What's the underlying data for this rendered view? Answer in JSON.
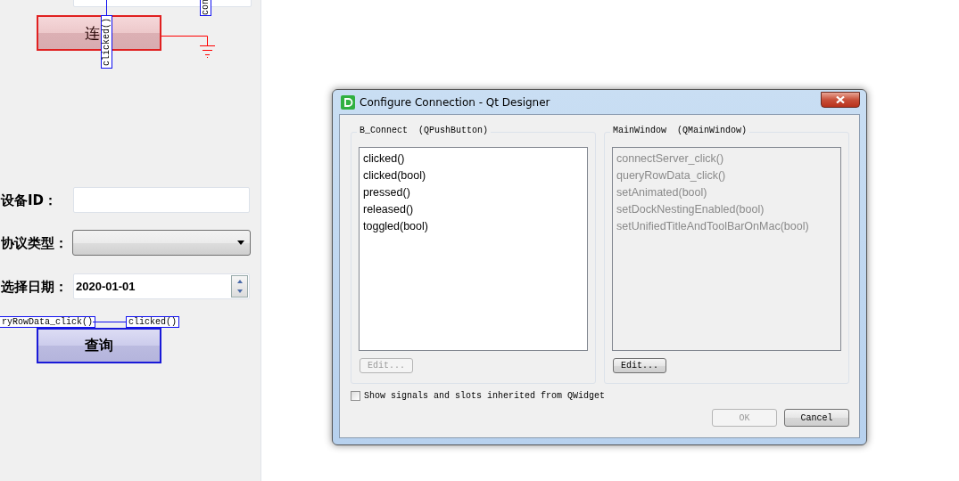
{
  "form": {
    "connect_button": {
      "label": "连"
    },
    "connections": [
      {
        "kind": "vertical",
        "signal": "clicked()",
        "slot": "con"
      },
      {
        "kind": "horizontal",
        "signal": "clicked()",
        "slot": "ryRowData_click()"
      }
    ],
    "fields": [
      {
        "kind": "text",
        "label": "设备ID："
      },
      {
        "kind": "combo",
        "label": "协议类型："
      },
      {
        "kind": "date",
        "label": "选择日期：",
        "value": "2020-01-01"
      }
    ],
    "query_button": {
      "label": "查询"
    }
  },
  "dialog": {
    "title": "Configure Connection - Qt Designer",
    "panels": [
      {
        "heading": "B_Connect  (QPushButton)",
        "disabled": false,
        "items": [
          "clicked()",
          "clicked(bool)",
          "pressed()",
          "released()",
          "toggled(bool)"
        ],
        "edit_button": {
          "label": "Edit...",
          "disabled": true
        }
      },
      {
        "heading": "MainWindow  (QMainWindow)",
        "disabled": true,
        "items": [
          "connectServer_click()",
          "queryRowData_click()",
          "setAnimated(bool)",
          "setDockNestingEnabled(bool)",
          "setUnifiedTitleAndToolBarOnMac(bool)"
        ],
        "edit_button": {
          "label": "Edit...",
          "disabled": false
        }
      }
    ],
    "inherited_checkbox": {
      "label": "Show signals and slots inherited from QWidget",
      "checked": false
    },
    "buttons": [
      {
        "label": "OK",
        "disabled": true
      },
      {
        "label": "Cancel",
        "disabled": false
      }
    ]
  }
}
